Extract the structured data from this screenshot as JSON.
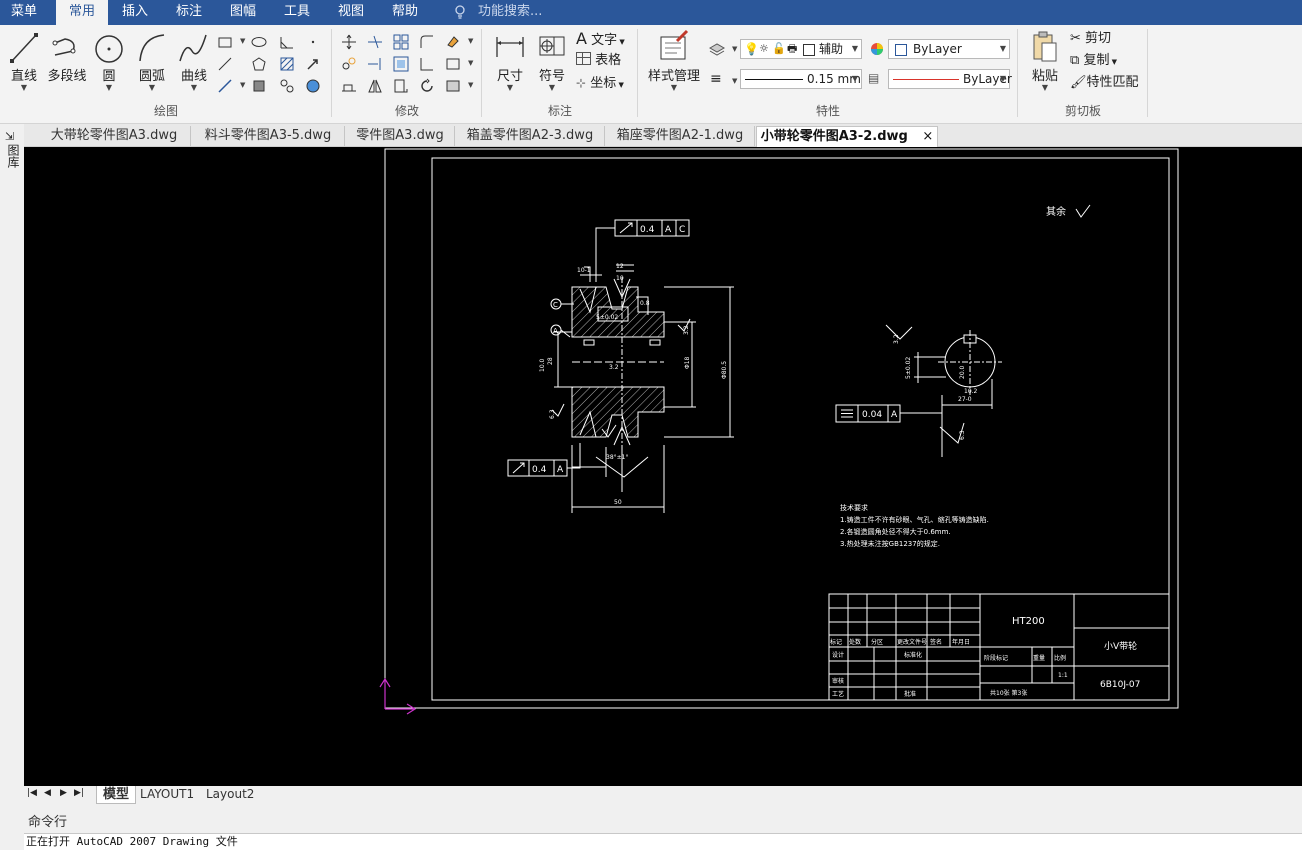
{
  "menubar": {
    "items": [
      "菜单",
      "常用",
      "插入",
      "标注",
      "图幅",
      "工具",
      "视图",
      "帮助"
    ],
    "active_index": 1,
    "search_placeholder": "功能搜索..."
  },
  "ribbon": {
    "draw": {
      "label": "绘图",
      "line": "直线",
      "polyline": "多段线",
      "circle": "圆",
      "arc": "圆弧",
      "curve": "曲线"
    },
    "modify": {
      "label": "修改"
    },
    "annotate": {
      "label": "标注",
      "dimension": "尺寸",
      "symbol": "符号",
      "text": "文字",
      "table": "表格",
      "coordinate": "坐标"
    },
    "properties": {
      "label": "特性",
      "style_manager": "样式管理",
      "layer_name": "辅助",
      "color_value": "ByLayer",
      "lineweight_value": "0.15 mm",
      "linetype_value": "ByLayer"
    },
    "clipboard": {
      "label": "剪切板",
      "paste": "粘贴",
      "cut": "剪切",
      "copy": "复制",
      "match": "特性匹配"
    }
  },
  "left_strip": {
    "label": "图库"
  },
  "doc_tabs": [
    "大带轮零件图A3.dwg",
    "料斗零件图A3-5.dwg",
    "零件图A3.dwg",
    "箱盖零件图A2-3.dwg",
    "箱座零件图A2-1.dwg",
    "小带轮零件图A3-2.dwg"
  ],
  "active_doc_tab": 5,
  "drawing": {
    "rough_note": "其余",
    "fcf1": [
      "0.4",
      "A",
      "C"
    ],
    "fcf2": [
      "0.4",
      "A"
    ],
    "fcf3": [
      "0.04",
      "A"
    ],
    "datums": [
      "C",
      "A"
    ],
    "dims": {
      "d1": "10-1",
      "d2": "12",
      "d3": "10",
      "d4": "5±0.02",
      "d5": "0.8",
      "d6": "Φ80.5",
      "d7": "Φ18",
      "d8": "3.2",
      "d9": "38°±1°",
      "d10": "10.0",
      "d11": "50",
      "d12": "6.3",
      "d13": "28",
      "d14": "3.2",
      "d15": "5±0.02",
      "d16": "10.2",
      "d17": "27-0",
      "d18": "3.2",
      "d19": "6.3",
      "d20": "20.0"
    },
    "tech_title": "技术要求",
    "tech_lines": [
      "1.铸造工件不许有砂眼、气孔、缩孔等铸造缺陷.",
      "2.各锻造圆角处径不得大于0.6mm.",
      "3.热处理未注按GB1237的规定."
    ],
    "title_block": {
      "material": "HT200",
      "part_name": "小V带轮",
      "drawing_no": "6B10J-07",
      "row_labels": [
        "标记",
        "处数",
        "分区",
        "更改文件号",
        "签名",
        "年月日"
      ],
      "design": "设计",
      "standardize": "标准化",
      "review": "审核",
      "process": "工艺",
      "approve": "批准",
      "stage": "阶段标记",
      "weight": "重量",
      "scale": "比例",
      "sheets": "共10张 第3张",
      "scale_value": "1:1"
    }
  },
  "layout_tabs": [
    "模型",
    "LAYOUT1",
    "Layout2"
  ],
  "command": {
    "label": "命令行",
    "line": "正在打开 AutoCAD 2007 Drawing 文件"
  },
  "colors": {
    "menubar": "#2b579a",
    "ribbon": "#f3f3f3",
    "canvas": "#000000",
    "ucs": "#cc33cc"
  }
}
